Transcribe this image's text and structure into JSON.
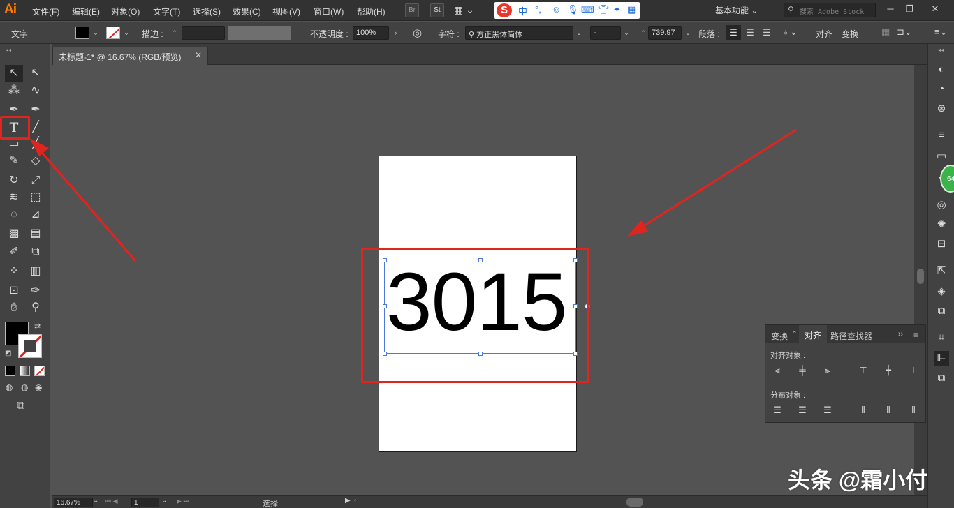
{
  "app": {
    "logo": "Ai"
  },
  "menu": [
    "文件(F)",
    "编辑(E)",
    "对象(O)",
    "文字(T)",
    "选择(S)",
    "效果(C)",
    "视图(V)",
    "窗口(W)",
    "帮助(H)"
  ],
  "menubar_icons": {
    "bridge": "Br",
    "stock": "St"
  },
  "ime": {
    "lang": "中",
    "punct": "°,"
  },
  "workspace": {
    "label": "基本功能"
  },
  "search": {
    "placeholder": "搜索 Adobe Stock"
  },
  "control": {
    "tool_label": "文字",
    "stroke_label": "描边 :",
    "opacity_label": "不透明度 :",
    "opacity_value": "100%",
    "char_label": "字符 :",
    "font_family": "方正黑体简体",
    "font_style": "-",
    "font_size": "739.97",
    "para_label": "段落 :",
    "align_label": "对齐",
    "transform_label": "变换"
  },
  "document_tab": {
    "title": "未标题-1* @ 16.67% (RGB/预览)"
  },
  "canvas": {
    "text": "3015"
  },
  "align_panel": {
    "tabs": [
      "变换",
      "对齐",
      "路径查找器"
    ],
    "align_objects_label": "对齐对象 :",
    "distribute_objects_label": "分布对象 :"
  },
  "status": {
    "zoom": "16.67%",
    "artboard": "1",
    "mode": "选择"
  },
  "notification_badge": "64",
  "watermark": "头条 @霜小付",
  "colors": {
    "accent_red": "#e02420",
    "selection_blue": "#4a7bd8",
    "ai_orange": "#ff7c00"
  }
}
